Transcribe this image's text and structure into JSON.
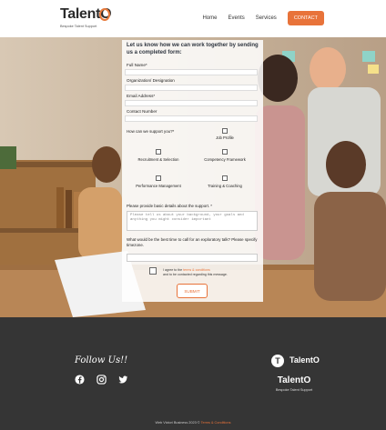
{
  "header": {
    "logo_text": "TalentO",
    "logo_tagline": "Bespoke Talent Support",
    "nav": [
      "Home",
      "Events",
      "Services"
    ],
    "contact_label": "CONTACT"
  },
  "form": {
    "title": "Let us know how we can work together by sending us a completed form:",
    "full_name": "Full Name*",
    "organization": "Organization/ Designation",
    "email": "Email Address*",
    "contact_number": "Contact Number",
    "support_question": "How can we support you?*",
    "options": {
      "job_profile": "Job Profile",
      "recruitment": "Recruitment & Selection",
      "competency": "Competency Framework",
      "performance": "Performance Management",
      "training": "Training & Coaching"
    },
    "details_label": "Please provide basic details about the support. *",
    "details_placeholder": "Please tell us about your background, your goals and anything you might consider important",
    "call_label": "What would be the best time to call for an exploratory talk? Please specify timezone.",
    "agree_prefix": "I agree to the",
    "agree_link": "terms & conditions",
    "agree_suffix": "and to be contacted regarding this message.",
    "submit_label": "SUBMIT"
  },
  "footer": {
    "follow_text": "Follow Us!!",
    "social": [
      "facebook-icon",
      "instagram-icon",
      "twitter-icon"
    ],
    "logo_small": "TalentO",
    "brand": "TalentO",
    "brand_tag": "Bespoke Talent Support",
    "copyright_prefix": "Web Victori Business 2023 ©",
    "copyright_link": "Terms & Conditions"
  },
  "colors": {
    "accent": "#e8733a",
    "footer_bg": "#353535"
  }
}
